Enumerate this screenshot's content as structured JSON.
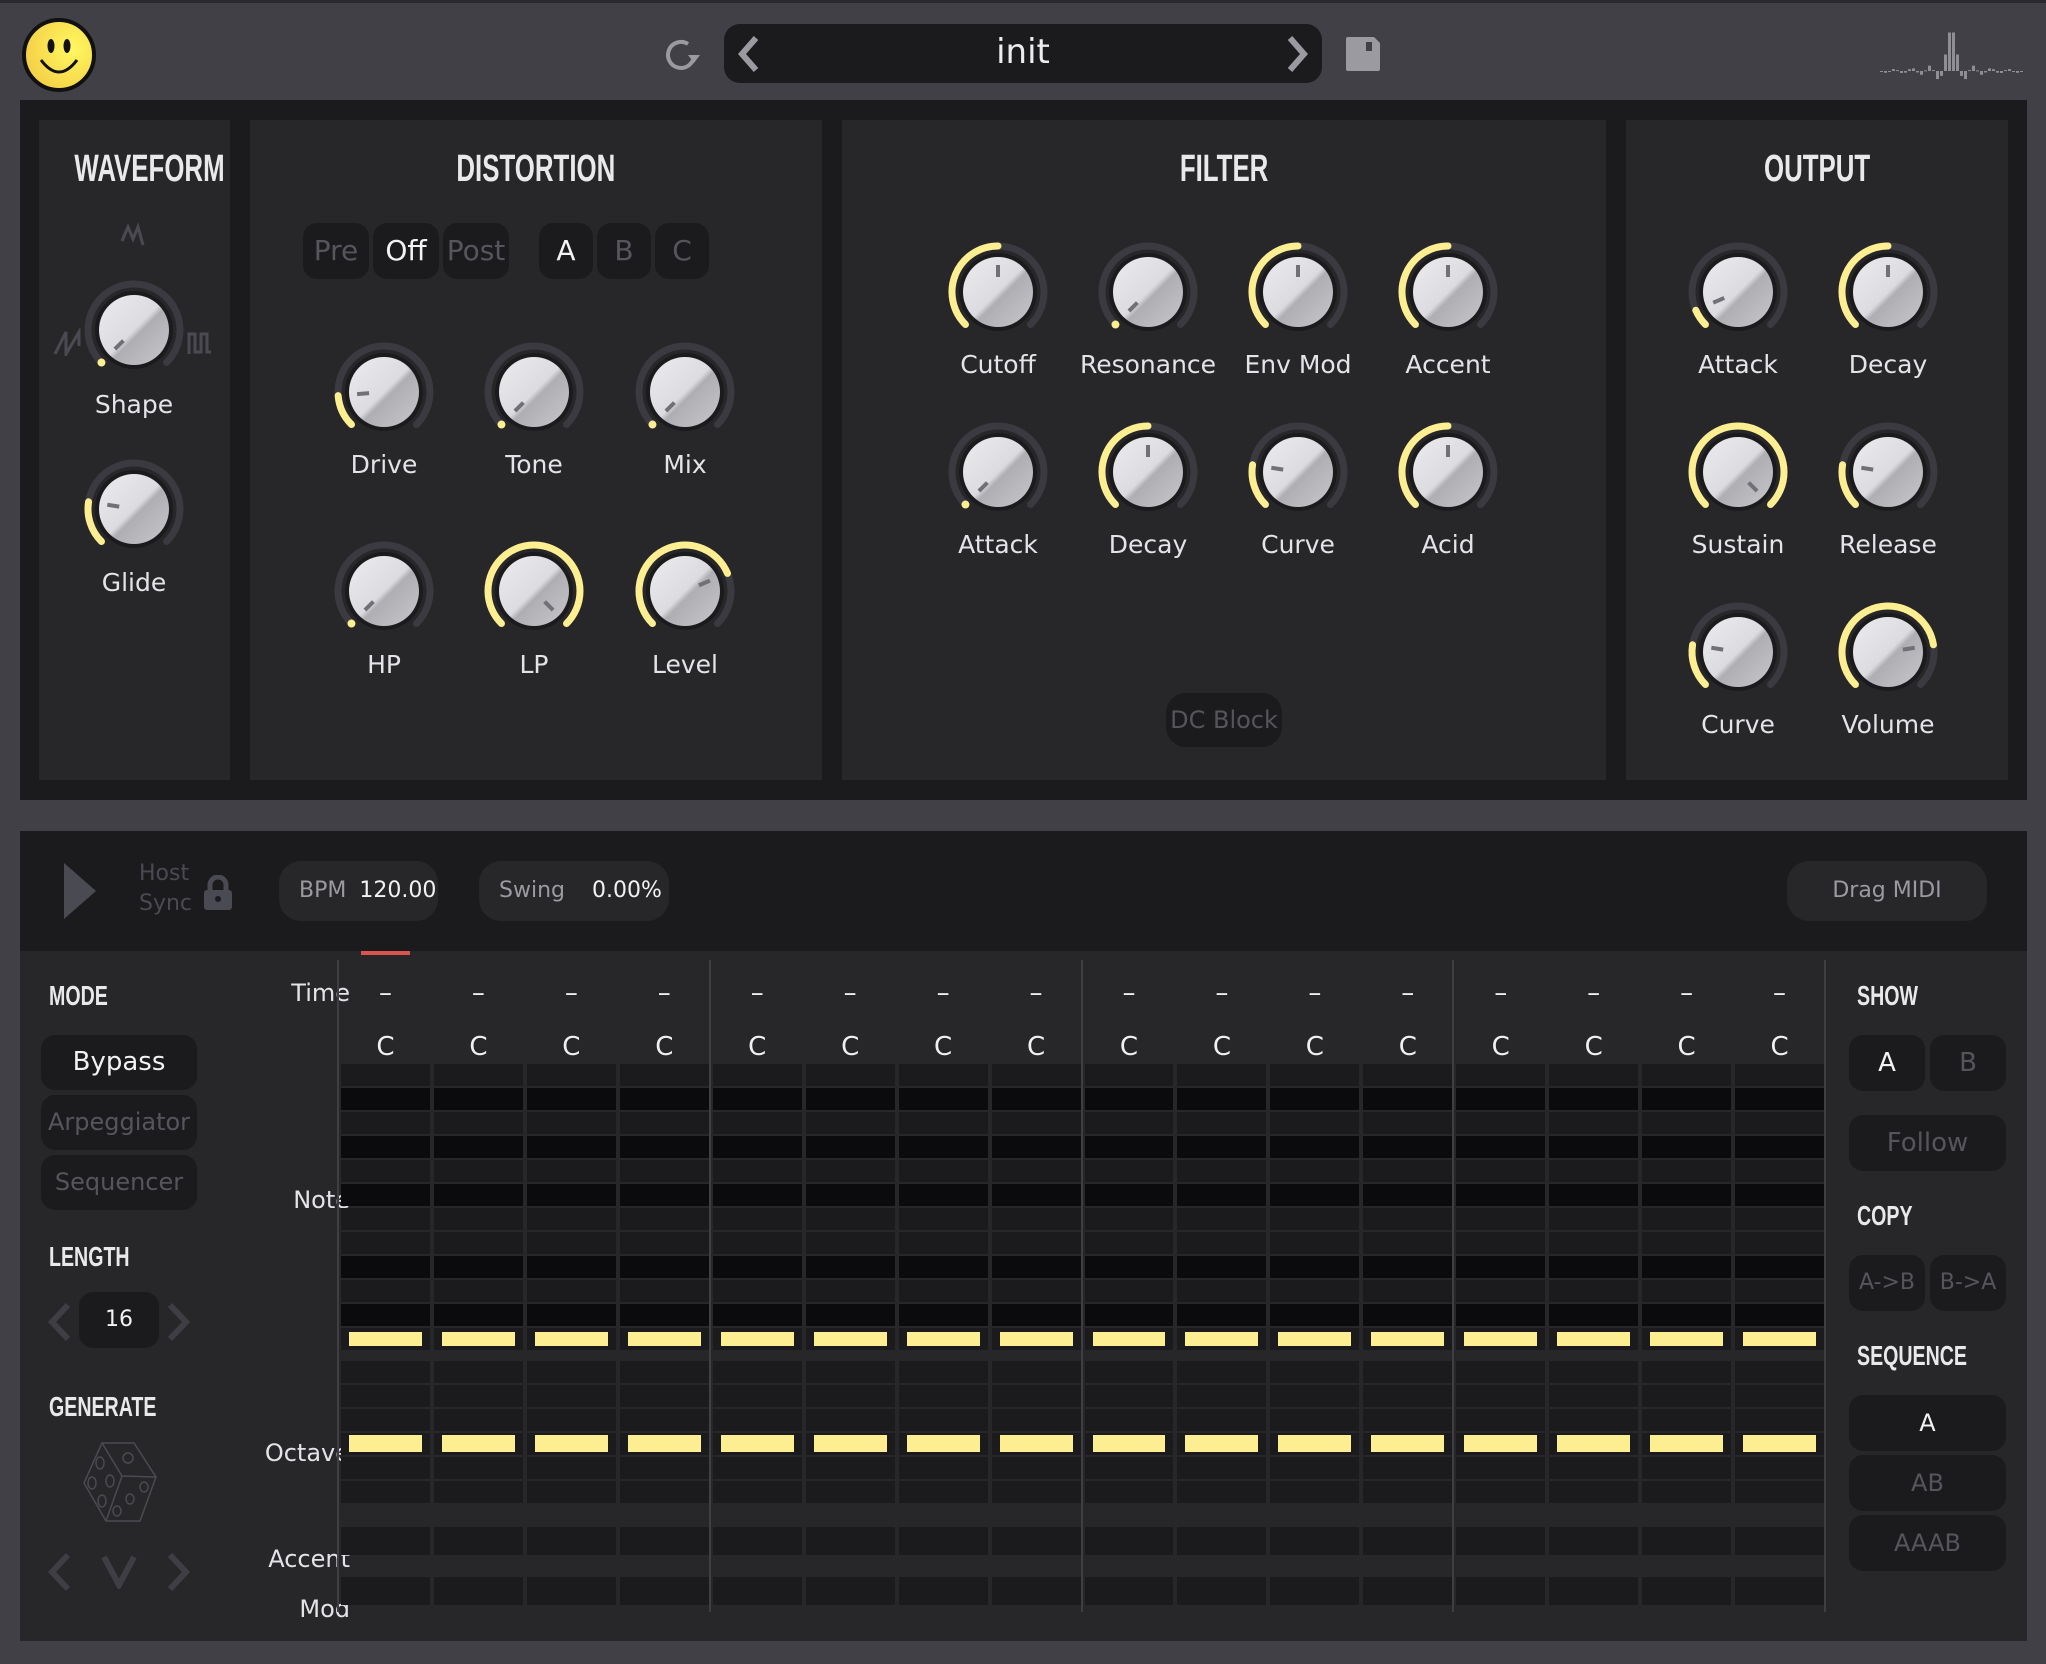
{
  "header": {
    "preset_name": "init",
    "icons": {
      "logo": "smiley-logo-icon",
      "refresh": "refresh-icon",
      "prev": "chevron-left-icon",
      "next": "chevron-right-icon",
      "save": "save-icon",
      "scope": "waveform-scope-icon"
    }
  },
  "colors": {
    "accent": "#fdef91",
    "background": "#414047",
    "panel": "#27272a",
    "panel_dark": "#1b1b1e",
    "playhead": "#d9534f"
  },
  "waveform": {
    "title": "WAVEFORM",
    "knobs": [
      {
        "label": "Shape",
        "value": 0.0
      },
      {
        "label": "Glide",
        "value": 0.2
      }
    ]
  },
  "distortion": {
    "title": "DISTORTION",
    "position_options": [
      {
        "label": "Pre",
        "active": false
      },
      {
        "label": "Off",
        "active": true
      },
      {
        "label": "Post",
        "active": false
      }
    ],
    "type_options": [
      {
        "label": "A",
        "active": true
      },
      {
        "label": "B",
        "active": false
      },
      {
        "label": "C",
        "active": false
      }
    ],
    "knobs": [
      {
        "label": "Drive",
        "value": 0.15
      },
      {
        "label": "Tone",
        "value": 0.0
      },
      {
        "label": "Mix",
        "value": 0.0
      },
      {
        "label": "HP",
        "value": 0.0
      },
      {
        "label": "LP",
        "value": 1.0
      },
      {
        "label": "Level",
        "value": 0.75
      }
    ]
  },
  "filter": {
    "title": "FILTER",
    "knobs": [
      {
        "label": "Cutoff",
        "value": 0.5
      },
      {
        "label": "Resonance",
        "value": 0.0
      },
      {
        "label": "Env Mod",
        "value": 0.5
      },
      {
        "label": "Accent",
        "value": 0.5
      },
      {
        "label": "Attack",
        "value": 0.0
      },
      {
        "label": "Decay",
        "value": 0.5
      },
      {
        "label": "Curve",
        "value": 0.2
      },
      {
        "label": "Acid",
        "value": 0.5
      }
    ],
    "dc_block_label": "DC Block"
  },
  "output": {
    "title": "OUTPUT",
    "knobs": [
      {
        "label": "Attack",
        "value": 0.08
      },
      {
        "label": "Decay",
        "value": 0.5
      },
      {
        "label": "Sustain",
        "value": 1.0
      },
      {
        "label": "Release",
        "value": 0.2
      },
      {
        "label": "Curve",
        "value": 0.2
      },
      {
        "label": "Volume",
        "value": 0.8
      }
    ]
  },
  "transport": {
    "play_icon": "play-icon",
    "host_sync_label_1": "Host",
    "host_sync_label_2": "Sync",
    "lock_icon": "lock-icon",
    "bpm_label": "BPM",
    "bpm_value": "120.00",
    "swing_label": "Swing",
    "swing_value": "0.00%",
    "drag_midi_label": "Drag MIDI"
  },
  "left_panel": {
    "mode_title": "MODE",
    "modes": [
      {
        "label": "Bypass",
        "active": true
      },
      {
        "label": "Arpeggiator",
        "active": false
      },
      {
        "label": "Sequencer",
        "active": false
      }
    ],
    "length_title": "LENGTH",
    "length_value": "16",
    "generate_title": "GENERATE",
    "generate_icons": [
      "dice-icon",
      "chevron-left-icon",
      "chevron-down-icon",
      "chevron-right-icon"
    ]
  },
  "grid": {
    "row_labels": {
      "time": "Time",
      "note": "Note",
      "octave": "Octave",
      "accent": "Accent",
      "mod": "Mod"
    },
    "steps": 16,
    "playhead_step": 1,
    "time_values": [
      "–",
      "–",
      "–",
      "–",
      "–",
      "–",
      "–",
      "–",
      "–",
      "–",
      "–",
      "–",
      "–",
      "–",
      "–",
      "–"
    ],
    "note_names": [
      "C",
      "C",
      "C",
      "C",
      "C",
      "C",
      "C",
      "C",
      "C",
      "C",
      "C",
      "C",
      "C",
      "C",
      "C",
      "C"
    ],
    "note_rows_pattern": [
      "light",
      "dark",
      "light",
      "dark",
      "light",
      "dark",
      "light",
      "light",
      "dark",
      "light",
      "dark",
      "active"
    ],
    "octave_rows": 6,
    "octave_active_row": 3,
    "accent_on": [
      false,
      false,
      false,
      false,
      false,
      false,
      false,
      false,
      false,
      false,
      false,
      false,
      false,
      false,
      false,
      false
    ],
    "mod_on": [
      false,
      false,
      false,
      false,
      false,
      false,
      false,
      false,
      false,
      false,
      false,
      false,
      false,
      false,
      false,
      false
    ]
  },
  "right_panel": {
    "show_title": "SHOW",
    "show_options": [
      {
        "label": "A",
        "active": true
      },
      {
        "label": "B",
        "active": false
      }
    ],
    "follow_label": "Follow",
    "copy_title": "COPY",
    "copy_options": [
      {
        "label": "A->B"
      },
      {
        "label": "B->A"
      }
    ],
    "sequence_title": "SEQUENCE",
    "sequence_options": [
      {
        "label": "A",
        "active": true
      },
      {
        "label": "AB",
        "active": false
      },
      {
        "label": "AAAB",
        "active": false
      }
    ]
  }
}
